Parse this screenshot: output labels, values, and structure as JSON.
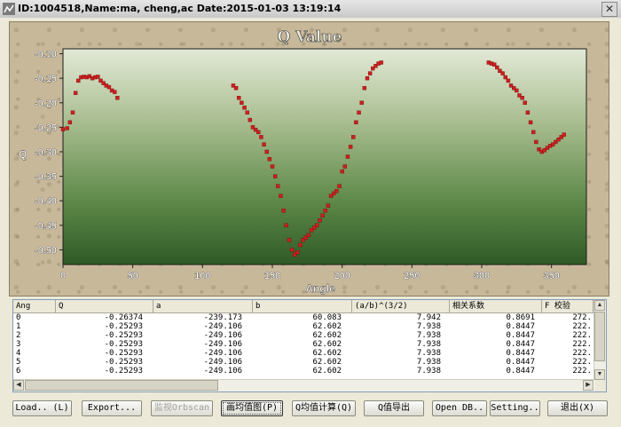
{
  "window": {
    "title": "ID:1004518,Name:ma, cheng,ac Date:2015-01-03 13:19:14",
    "close_label": "✕"
  },
  "chart_data": {
    "type": "scatter",
    "title": "Q Value",
    "xlabel": "Angle",
    "ylabel": "Q",
    "xlim": [
      0,
      375
    ],
    "ylim": [
      -0.53,
      -0.09
    ],
    "xticks": [
      0,
      50,
      100,
      150,
      200,
      250,
      300,
      350
    ],
    "yticks": [
      -0.1,
      -0.15,
      -0.2,
      -0.25,
      -0.3,
      -0.35,
      -0.4,
      -0.45,
      -0.5
    ],
    "ytick_labels": [
      "-0.10",
      "-0.15",
      "-0.20",
      "-0.25",
      "-0.30",
      "-0.35",
      "-0.40",
      "-0.45",
      "-0.50"
    ],
    "xtick_labels": [
      "0",
      "50",
      "100",
      "150",
      "200",
      "250",
      "300",
      "350"
    ],
    "background": "green-gradient",
    "marker_color": "#cc2020",
    "points": [
      [
        0,
        -0.254
      ],
      [
        3,
        -0.252
      ],
      [
        5,
        -0.24
      ],
      [
        7,
        -0.22
      ],
      [
        9,
        -0.18
      ],
      [
        11,
        -0.155
      ],
      [
        13,
        -0.148
      ],
      [
        15,
        -0.147
      ],
      [
        17,
        -0.148
      ],
      [
        19,
        -0.146
      ],
      [
        21,
        -0.15
      ],
      [
        23,
        -0.148
      ],
      [
        25,
        -0.147
      ],
      [
        27,
        -0.155
      ],
      [
        29,
        -0.16
      ],
      [
        31,
        -0.165
      ],
      [
        33,
        -0.168
      ],
      [
        35,
        -0.175
      ],
      [
        37,
        -0.178
      ],
      [
        39,
        -0.19
      ],
      [
        122,
        -0.165
      ],
      [
        124,
        -0.17
      ],
      [
        126,
        -0.19
      ],
      [
        128,
        -0.2
      ],
      [
        130,
        -0.21
      ],
      [
        132,
        -0.22
      ],
      [
        134,
        -0.235
      ],
      [
        136,
        -0.25
      ],
      [
        138,
        -0.255
      ],
      [
        140,
        -0.26
      ],
      [
        142,
        -0.27
      ],
      [
        144,
        -0.285
      ],
      [
        146,
        -0.3
      ],
      [
        148,
        -0.315
      ],
      [
        150,
        -0.33
      ],
      [
        152,
        -0.35
      ],
      [
        154,
        -0.37
      ],
      [
        156,
        -0.39
      ],
      [
        158,
        -0.42
      ],
      [
        160,
        -0.45
      ],
      [
        162,
        -0.48
      ],
      [
        164,
        -0.5
      ],
      [
        166,
        -0.51
      ],
      [
        168,
        -0.505
      ],
      [
        170,
        -0.49
      ],
      [
        172,
        -0.48
      ],
      [
        174,
        -0.475
      ],
      [
        176,
        -0.47
      ],
      [
        178,
        -0.46
      ],
      [
        180,
        -0.455
      ],
      [
        182,
        -0.45
      ],
      [
        184,
        -0.44
      ],
      [
        186,
        -0.43
      ],
      [
        188,
        -0.42
      ],
      [
        190,
        -0.41
      ],
      [
        192,
        -0.39
      ],
      [
        194,
        -0.385
      ],
      [
        196,
        -0.38
      ],
      [
        198,
        -0.37
      ],
      [
        200,
        -0.34
      ],
      [
        202,
        -0.33
      ],
      [
        204,
        -0.31
      ],
      [
        206,
        -0.29
      ],
      [
        208,
        -0.27
      ],
      [
        210,
        -0.24
      ],
      [
        212,
        -0.22
      ],
      [
        214,
        -0.2
      ],
      [
        216,
        -0.17
      ],
      [
        218,
        -0.15
      ],
      [
        220,
        -0.14
      ],
      [
        222,
        -0.13
      ],
      [
        224,
        -0.125
      ],
      [
        226,
        -0.12
      ],
      [
        228,
        -0.118
      ],
      [
        305,
        -0.118
      ],
      [
        307,
        -0.12
      ],
      [
        309,
        -0.122
      ],
      [
        311,
        -0.128
      ],
      [
        313,
        -0.135
      ],
      [
        315,
        -0.14
      ],
      [
        317,
        -0.148
      ],
      [
        319,
        -0.155
      ],
      [
        321,
        -0.165
      ],
      [
        323,
        -0.17
      ],
      [
        325,
        -0.175
      ],
      [
        327,
        -0.185
      ],
      [
        329,
        -0.19
      ],
      [
        331,
        -0.2
      ],
      [
        333,
        -0.22
      ],
      [
        335,
        -0.24
      ],
      [
        337,
        -0.26
      ],
      [
        339,
        -0.28
      ],
      [
        341,
        -0.295
      ],
      [
        343,
        -0.3
      ],
      [
        345,
        -0.297
      ],
      [
        347,
        -0.292
      ],
      [
        349,
        -0.288
      ],
      [
        351,
        -0.285
      ],
      [
        353,
        -0.28
      ],
      [
        355,
        -0.275
      ],
      [
        357,
        -0.27
      ],
      [
        359,
        -0.265
      ]
    ]
  },
  "table": {
    "columns": [
      "Ang",
      "Q",
      "a",
      "b",
      "(a/b)^(3/2)",
      "相关系数",
      "F 校验"
    ],
    "rows": [
      [
        "0",
        "-0.26374",
        "-239.173",
        "60.083",
        "7.942",
        "0.8691",
        "272."
      ],
      [
        "1",
        "-0.25293",
        "-249.106",
        "62.602",
        "7.938",
        "0.8447",
        "222."
      ],
      [
        "2",
        "-0.25293",
        "-249.106",
        "62.602",
        "7.938",
        "0.8447",
        "222."
      ],
      [
        "3",
        "-0.25293",
        "-249.106",
        "62.602",
        "7.938",
        "0.8447",
        "222."
      ],
      [
        "4",
        "-0.25293",
        "-249.106",
        "62.602",
        "7.938",
        "0.8447",
        "222."
      ],
      [
        "5",
        "-0.25293",
        "-249.106",
        "62.602",
        "7.938",
        "0.8447",
        "222."
      ],
      [
        "6",
        "-0.25293",
        "-249.106",
        "62.602",
        "7.938",
        "0.8447",
        "222."
      ]
    ]
  },
  "buttons": {
    "load": "Load.. (L)",
    "export": "Export...",
    "monitor": "监视Orbscan",
    "draw_mean": "画均值图(P)",
    "calc_q_mean": "Q均值计算(Q)",
    "export_q": "Q值导出",
    "open_db": "Open DB..",
    "setting": "Setting..",
    "exit": "退出(X)"
  }
}
